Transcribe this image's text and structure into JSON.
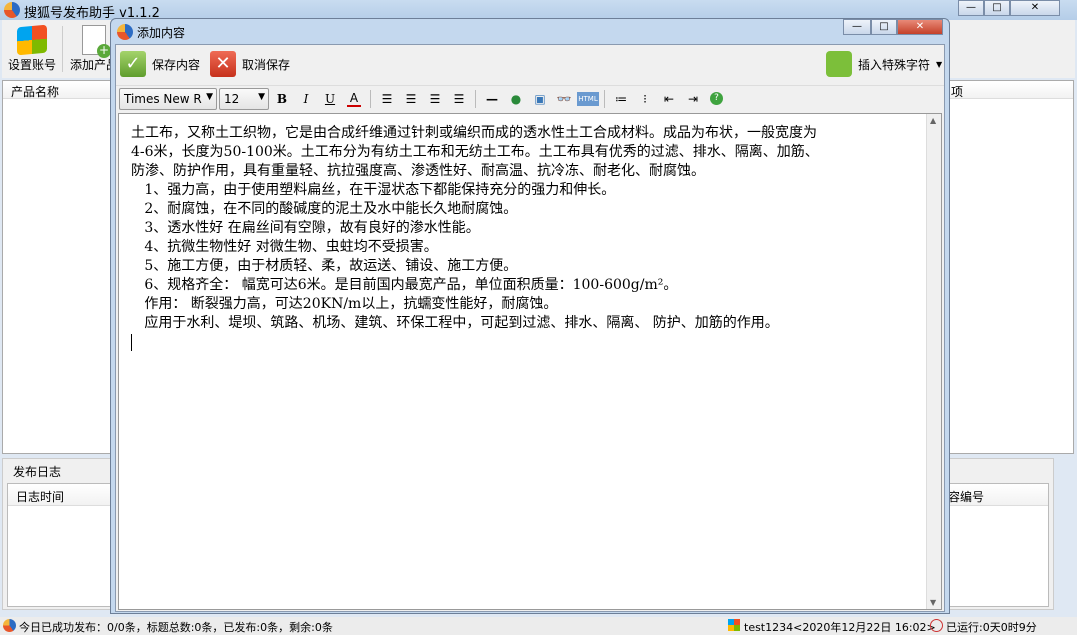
{
  "app": {
    "title": "搜狐号发布助手 v1.1.2",
    "window_controls": [
      "minimize",
      "maximize",
      "close"
    ]
  },
  "toolbar": {
    "set_account": "设置账号",
    "add_product": "添加产品"
  },
  "list": {
    "columns": [
      "产品名称"
    ],
    "right_col_partial": "项"
  },
  "log": {
    "group_title": "发布日志",
    "columns": [
      "日志时间"
    ],
    "right_col_partial": "容编号"
  },
  "status": {
    "left": "今日已成功发布：0/0条，标题总数:0条，已发布:0条，剩余:0条",
    "user": "test1234<2020年12月22日 16:02>",
    "runtime": "已运行:0天0时9分"
  },
  "dialog": {
    "title": "添加内容",
    "save": "保存内容",
    "cancel": "取消保存",
    "insert_special": "插入特殊字符",
    "font": "Times New R",
    "size": "12",
    "format_buttons": [
      "bold",
      "italic",
      "underline",
      "font-color",
      "align-left",
      "align-center",
      "align-right",
      "justify",
      "horizontal-rule",
      "link",
      "image",
      "find",
      "html",
      "ordered-list",
      "unordered-list",
      "outdent",
      "indent",
      "help"
    ],
    "content": [
      "土工布，又称土工织物，它是由合成纤维通过针刺或编织而成的透水性土工合成材料。成品为布状，一般宽度为",
      "4-6米，长度为50-100米。土工布分为有纺土工布和无纺土工布。土工布具有优秀的过滤、排水、隔离、加筋、",
      "防渗、防护作用，具有重量轻、抗拉强度高、渗透性好、耐高温、抗冷冻、耐老化、耐腐蚀。",
      "   1、强力高，由于使用塑料扁丝，在干湿状态下都能保持充分的强力和伸长。",
      "   2、耐腐蚀，在不同的酸碱度的泥土及水中能长久地耐腐蚀。",
      "   3、透水性好 在扁丝间有空隙，故有良好的渗水性能。",
      "   4、抗微生物性好 对微生物、虫蛀均不受损害。",
      "   5、施工方便，由于材质轻、柔，故运送、铺设、施工方便。",
      "   6、规格齐全： 幅宽可达6米。是目前国内最宽产品，单位面积质量：100-600g/m²。",
      "   作用： 断裂强力高，可达20KN/m以上，抗蠕变性能好，耐腐蚀。",
      "   应用于水利、堤坝、筑路、机场、建筑、环保工程中，可起到过滤、排水、隔离、 防护、加筋的作用。"
    ]
  }
}
